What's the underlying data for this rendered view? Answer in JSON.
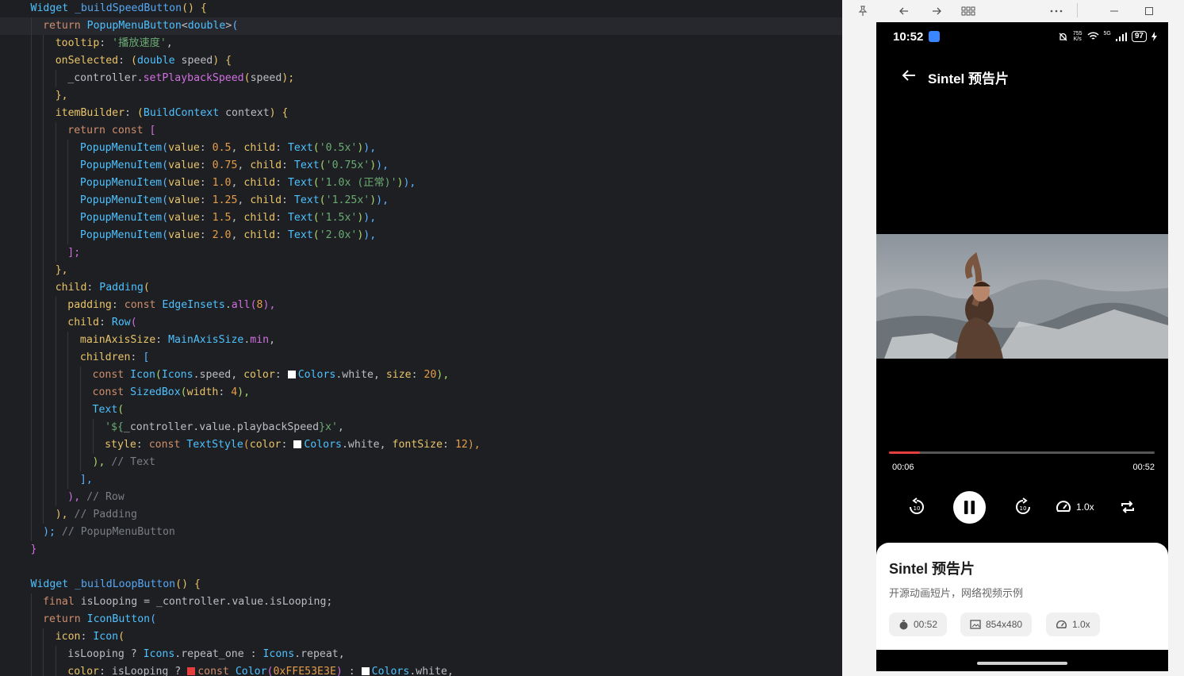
{
  "editor": {
    "lines": [
      [
        {
          "t": "Widget ",
          "c": "ty"
        },
        {
          "t": "_buildSpeedButton",
          "c": "fn"
        },
        {
          "t": "() {",
          "c": "yw"
        }
      ],
      [
        {
          "t": "return ",
          "c": "kw"
        },
        {
          "t": "PopupMenuButton",
          "c": "ty"
        },
        {
          "t": "<",
          "c": "vr"
        },
        {
          "t": "double",
          "c": "ty"
        },
        {
          "t": ">",
          "c": "vr"
        },
        {
          "t": "(",
          "c": "bl"
        }
      ],
      [
        {
          "t": "tooltip",
          "c": "yw"
        },
        {
          "t": ": ",
          "c": "vr"
        },
        {
          "t": "'播放速度'",
          "c": "st"
        },
        {
          "t": ",",
          "c": "vr"
        }
      ],
      [
        {
          "t": "onSelected",
          "c": "yw"
        },
        {
          "t": ": ",
          "c": "vr"
        },
        {
          "t": "(",
          "c": "yw"
        },
        {
          "t": "double ",
          "c": "ty"
        },
        {
          "t": "speed",
          "c": "vr"
        },
        {
          "t": ") {",
          "c": "yw"
        }
      ],
      [
        {
          "t": "_controller",
          "c": "vr"
        },
        {
          "t": ".",
          "c": "vr"
        },
        {
          "t": "setPlaybackSpeed",
          "c": "mg"
        },
        {
          "t": "(",
          "c": "yw"
        },
        {
          "t": "speed",
          "c": "vr"
        },
        {
          "t": ");",
          "c": "yw"
        }
      ],
      [
        {
          "t": "},",
          "c": "yw"
        }
      ],
      [
        {
          "t": "itemBuilder",
          "c": "yw"
        },
        {
          "t": ": ",
          "c": "vr"
        },
        {
          "t": "(",
          "c": "yw"
        },
        {
          "t": "BuildContext ",
          "c": "ty"
        },
        {
          "t": "context",
          "c": "vr"
        },
        {
          "t": ") {",
          "c": "yw"
        }
      ],
      [
        {
          "t": "return ",
          "c": "kw"
        },
        {
          "t": "const ",
          "c": "kw"
        },
        {
          "t": "[",
          "c": "mg"
        }
      ],
      [
        {
          "t": "PopupMenuItem",
          "c": "ty"
        },
        {
          "t": "(",
          "c": "bl"
        },
        {
          "t": "value",
          "c": "yw"
        },
        {
          "t": ": ",
          "c": "vr"
        },
        {
          "t": "0.5",
          "c": "or"
        },
        {
          "t": ", ",
          "c": "vr"
        },
        {
          "t": "child",
          "c": "yw"
        },
        {
          "t": ": ",
          "c": "vr"
        },
        {
          "t": "Text",
          "c": "ty"
        },
        {
          "t": "(",
          "c": "gn"
        },
        {
          "t": "'0.5x'",
          "c": "st"
        },
        {
          "t": ")",
          "c": "gn"
        },
        {
          "t": "),",
          "c": "bl"
        }
      ],
      [
        {
          "t": "PopupMenuItem",
          "c": "ty"
        },
        {
          "t": "(",
          "c": "bl"
        },
        {
          "t": "value",
          "c": "yw"
        },
        {
          "t": ": ",
          "c": "vr"
        },
        {
          "t": "0.75",
          "c": "or"
        },
        {
          "t": ", ",
          "c": "vr"
        },
        {
          "t": "child",
          "c": "yw"
        },
        {
          "t": ": ",
          "c": "vr"
        },
        {
          "t": "Text",
          "c": "ty"
        },
        {
          "t": "(",
          "c": "gn"
        },
        {
          "t": "'0.75x'",
          "c": "st"
        },
        {
          "t": ")",
          "c": "gn"
        },
        {
          "t": "),",
          "c": "bl"
        }
      ],
      [
        {
          "t": "PopupMenuItem",
          "c": "ty"
        },
        {
          "t": "(",
          "c": "bl"
        },
        {
          "t": "value",
          "c": "yw"
        },
        {
          "t": ": ",
          "c": "vr"
        },
        {
          "t": "1.0",
          "c": "or"
        },
        {
          "t": ", ",
          "c": "vr"
        },
        {
          "t": "child",
          "c": "yw"
        },
        {
          "t": ": ",
          "c": "vr"
        },
        {
          "t": "Text",
          "c": "ty"
        },
        {
          "t": "(",
          "c": "gn"
        },
        {
          "t": "'1.0x (正常)'",
          "c": "st"
        },
        {
          "t": ")",
          "c": "gn"
        },
        {
          "t": "),",
          "c": "bl"
        }
      ],
      [
        {
          "t": "PopupMenuItem",
          "c": "ty"
        },
        {
          "t": "(",
          "c": "bl"
        },
        {
          "t": "value",
          "c": "yw"
        },
        {
          "t": ": ",
          "c": "vr"
        },
        {
          "t": "1.25",
          "c": "or"
        },
        {
          "t": ", ",
          "c": "vr"
        },
        {
          "t": "child",
          "c": "yw"
        },
        {
          "t": ": ",
          "c": "vr"
        },
        {
          "t": "Text",
          "c": "ty"
        },
        {
          "t": "(",
          "c": "gn"
        },
        {
          "t": "'1.25x'",
          "c": "st"
        },
        {
          "t": ")",
          "c": "gn"
        },
        {
          "t": "),",
          "c": "bl"
        }
      ],
      [
        {
          "t": "PopupMenuItem",
          "c": "ty"
        },
        {
          "t": "(",
          "c": "bl"
        },
        {
          "t": "value",
          "c": "yw"
        },
        {
          "t": ": ",
          "c": "vr"
        },
        {
          "t": "1.5",
          "c": "or"
        },
        {
          "t": ", ",
          "c": "vr"
        },
        {
          "t": "child",
          "c": "yw"
        },
        {
          "t": ": ",
          "c": "vr"
        },
        {
          "t": "Text",
          "c": "ty"
        },
        {
          "t": "(",
          "c": "gn"
        },
        {
          "t": "'1.5x'",
          "c": "st"
        },
        {
          "t": ")",
          "c": "gn"
        },
        {
          "t": "),",
          "c": "bl"
        }
      ],
      [
        {
          "t": "PopupMenuItem",
          "c": "ty"
        },
        {
          "t": "(",
          "c": "bl"
        },
        {
          "t": "value",
          "c": "yw"
        },
        {
          "t": ": ",
          "c": "vr"
        },
        {
          "t": "2.0",
          "c": "or"
        },
        {
          "t": ", ",
          "c": "vr"
        },
        {
          "t": "child",
          "c": "yw"
        },
        {
          "t": ": ",
          "c": "vr"
        },
        {
          "t": "Text",
          "c": "ty"
        },
        {
          "t": "(",
          "c": "gn"
        },
        {
          "t": "'2.0x'",
          "c": "st"
        },
        {
          "t": ")",
          "c": "gn"
        },
        {
          "t": "),",
          "c": "bl"
        }
      ],
      [
        {
          "t": "];",
          "c": "mg"
        }
      ],
      [
        {
          "t": "},",
          "c": "yw"
        }
      ],
      [
        {
          "t": "child",
          "c": "yw"
        },
        {
          "t": ": ",
          "c": "vr"
        },
        {
          "t": "Padding",
          "c": "ty"
        },
        {
          "t": "(",
          "c": "yw"
        }
      ],
      [
        {
          "t": "padding",
          "c": "yw"
        },
        {
          "t": ": ",
          "c": "vr"
        },
        {
          "t": "const ",
          "c": "kw"
        },
        {
          "t": "EdgeInsets",
          "c": "ty"
        },
        {
          "t": ".",
          "c": "vr"
        },
        {
          "t": "all",
          "c": "mg"
        },
        {
          "t": "(",
          "c": "mg"
        },
        {
          "t": "8",
          "c": "or"
        },
        {
          "t": "),",
          "c": "mg"
        }
      ],
      [
        {
          "t": "child",
          "c": "yw"
        },
        {
          "t": ": ",
          "c": "vr"
        },
        {
          "t": "Row",
          "c": "ty"
        },
        {
          "t": "(",
          "c": "mg"
        }
      ],
      [
        {
          "t": "mainAxisSize",
          "c": "yw"
        },
        {
          "t": ": ",
          "c": "vr"
        },
        {
          "t": "MainAxisSize",
          "c": "ty"
        },
        {
          "t": ".",
          "c": "vr"
        },
        {
          "t": "min",
          "c": "mg"
        },
        {
          "t": ",",
          "c": "vr"
        }
      ],
      [
        {
          "t": "children",
          "c": "yw"
        },
        {
          "t": ": ",
          "c": "vr"
        },
        {
          "t": "[",
          "c": "bl"
        }
      ],
      [
        {
          "t": "const ",
          "c": "kw"
        },
        {
          "t": "Icon",
          "c": "ty"
        },
        {
          "t": "(",
          "c": "gn"
        },
        {
          "t": "Icons",
          "c": "ty"
        },
        {
          "t": ".speed, ",
          "c": "vr"
        },
        {
          "t": "color",
          "c": "yw"
        },
        {
          "t": ": ",
          "c": "vr"
        },
        {
          "t": "■",
          "c": "sw-white"
        },
        {
          "t": "Colors",
          "c": "ty"
        },
        {
          "t": ".white, ",
          "c": "vr"
        },
        {
          "t": "size",
          "c": "yw"
        },
        {
          "t": ": ",
          "c": "vr"
        },
        {
          "t": "20",
          "c": "or"
        },
        {
          "t": "),",
          "c": "gn"
        }
      ],
      [
        {
          "t": "const ",
          "c": "kw"
        },
        {
          "t": "SizedBox",
          "c": "ty"
        },
        {
          "t": "(",
          "c": "gn"
        },
        {
          "t": "width",
          "c": "yw"
        },
        {
          "t": ": ",
          "c": "vr"
        },
        {
          "t": "4",
          "c": "or"
        },
        {
          "t": "),",
          "c": "gn"
        }
      ],
      [
        {
          "t": "Text",
          "c": "ty"
        },
        {
          "t": "(",
          "c": "gn"
        }
      ],
      [
        {
          "t": "'${",
          "c": "st"
        },
        {
          "t": "_controller.value.playbackSpeed",
          "c": "vr"
        },
        {
          "t": "}x'",
          "c": "st"
        },
        {
          "t": ",",
          "c": "vr"
        }
      ],
      [
        {
          "t": "style",
          "c": "yw"
        },
        {
          "t": ": ",
          "c": "vr"
        },
        {
          "t": "const ",
          "c": "kw"
        },
        {
          "t": "TextStyle",
          "c": "ty"
        },
        {
          "t": "(",
          "c": "or"
        },
        {
          "t": "color",
          "c": "yw"
        },
        {
          "t": ": ",
          "c": "vr"
        },
        {
          "t": "■",
          "c": "sw-white"
        },
        {
          "t": "Colors",
          "c": "ty"
        },
        {
          "t": ".white, ",
          "c": "vr"
        },
        {
          "t": "fontSize",
          "c": "yw"
        },
        {
          "t": ": ",
          "c": "vr"
        },
        {
          "t": "12",
          "c": "or"
        },
        {
          "t": "),",
          "c": "or"
        }
      ],
      [
        {
          "t": "), ",
          "c": "gn"
        },
        {
          "t": "// Text",
          "c": "cm"
        }
      ],
      [
        {
          "t": "],",
          "c": "bl"
        }
      ],
      [
        {
          "t": "), ",
          "c": "mg"
        },
        {
          "t": "// Row",
          "c": "cm"
        }
      ],
      [
        {
          "t": "), ",
          "c": "yw"
        },
        {
          "t": "// Padding",
          "c": "cm"
        }
      ],
      [
        {
          "t": "); ",
          "c": "bl"
        },
        {
          "t": "// PopupMenuButton",
          "c": "cm"
        }
      ],
      [
        {
          "t": "}",
          "c": "mg"
        }
      ],
      [],
      [
        {
          "t": "Widget ",
          "c": "ty"
        },
        {
          "t": "_buildLoopButton",
          "c": "fn"
        },
        {
          "t": "() {",
          "c": "yw"
        }
      ],
      [
        {
          "t": "final ",
          "c": "kw"
        },
        {
          "t": "isLooping ",
          "c": "vr"
        },
        {
          "t": "= ",
          "c": "vr"
        },
        {
          "t": "_controller",
          "c": "vr"
        },
        {
          "t": ".value.isLooping;",
          "c": "vr"
        }
      ],
      [
        {
          "t": "return ",
          "c": "kw"
        },
        {
          "t": "IconButton",
          "c": "ty"
        },
        {
          "t": "(",
          "c": "bl"
        }
      ],
      [
        {
          "t": "icon",
          "c": "yw"
        },
        {
          "t": ": ",
          "c": "vr"
        },
        {
          "t": "Icon",
          "c": "ty"
        },
        {
          "t": "(",
          "c": "yw"
        }
      ],
      [
        {
          "t": "isLooping ",
          "c": "vr"
        },
        {
          "t": "? ",
          "c": "vr"
        },
        {
          "t": "Icons",
          "c": "ty"
        },
        {
          "t": ".repeat_one ",
          "c": "vr"
        },
        {
          "t": ": ",
          "c": "vr"
        },
        {
          "t": "Icons",
          "c": "ty"
        },
        {
          "t": ".repeat,",
          "c": "vr"
        }
      ],
      [
        {
          "t": "color",
          "c": "yw"
        },
        {
          "t": ": ",
          "c": "vr"
        },
        {
          "t": "isLooping ",
          "c": "vr"
        },
        {
          "t": "? ",
          "c": "vr"
        },
        {
          "t": "■",
          "c": "sw-red"
        },
        {
          "t": "const ",
          "c": "kw"
        },
        {
          "t": "Color",
          "c": "ty"
        },
        {
          "t": "(",
          "c": "mg"
        },
        {
          "t": "0xFFE53E3E",
          "c": "or"
        },
        {
          "t": ") ",
          "c": "mg"
        },
        {
          "t": ": ",
          "c": "vr"
        },
        {
          "t": "■",
          "c": "sw-white"
        },
        {
          "t": "Colors",
          "c": "ty"
        },
        {
          "t": ".white,",
          "c": "vr"
        }
      ]
    ],
    "indents": [
      0,
      1,
      2,
      2,
      3,
      2,
      2,
      3,
      4,
      4,
      4,
      4,
      4,
      4,
      3,
      2,
      2,
      3,
      3,
      4,
      4,
      5,
      5,
      5,
      6,
      6,
      5,
      4,
      3,
      2,
      1,
      0,
      0,
      0,
      1,
      1,
      2,
      3,
      3
    ]
  },
  "phone": {
    "status": {
      "time": "10:52",
      "speed": "755\nK/s",
      "network": "5G",
      "battery": "97"
    },
    "appbar_title": "Sintel 预告片",
    "progress_fraction": 0.115,
    "time_current": "00:06",
    "time_total": "00:52",
    "speed_label": "1.0x",
    "card": {
      "title": "Sintel 预告片",
      "subtitle": "开源动画短片，网络视频示例",
      "chips": [
        "00:52",
        "854x480",
        "1.0x"
      ]
    }
  },
  "colors": {
    "accent_red": "#E53E3E",
    "code_bg": "#1e1f22"
  }
}
